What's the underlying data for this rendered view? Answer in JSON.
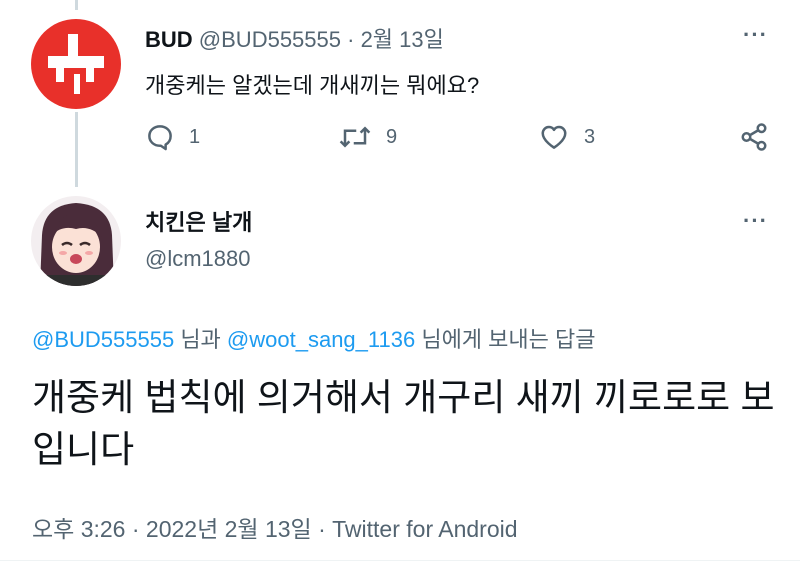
{
  "tweet1": {
    "display_name": "BUD",
    "handle": "@BUD555555",
    "separator": " · ",
    "date": "2월 13일",
    "text": "개중케는 알겠는데 개새끼는 뭐에요?",
    "reply_count": "1",
    "retweet_count": "9",
    "like_count": "3",
    "more_label": "···"
  },
  "tweet2": {
    "display_name": "치킨은 날개",
    "handle": "@lcm1880",
    "more_label": "···",
    "reply_to": {
      "mention1": "@BUD555555",
      "joiner": " 님과 ",
      "mention2": "@woot_sang_1136",
      "suffix": " 님에게 보내는 답글"
    },
    "text": "개중케 법칙에 의거해서 개구리 새끼 끼로로로 보입니다",
    "timestamp": "오후 3:26 · 2022년 2월 13일 · Twitter for Android"
  },
  "colors": {
    "accent": "#1d9bf0",
    "muted": "#536471",
    "text": "#0f1419",
    "bud_avatar": "#e8302a"
  },
  "icons": [
    "reply-icon",
    "retweet-icon",
    "like-icon",
    "share-icon",
    "more-icon"
  ]
}
